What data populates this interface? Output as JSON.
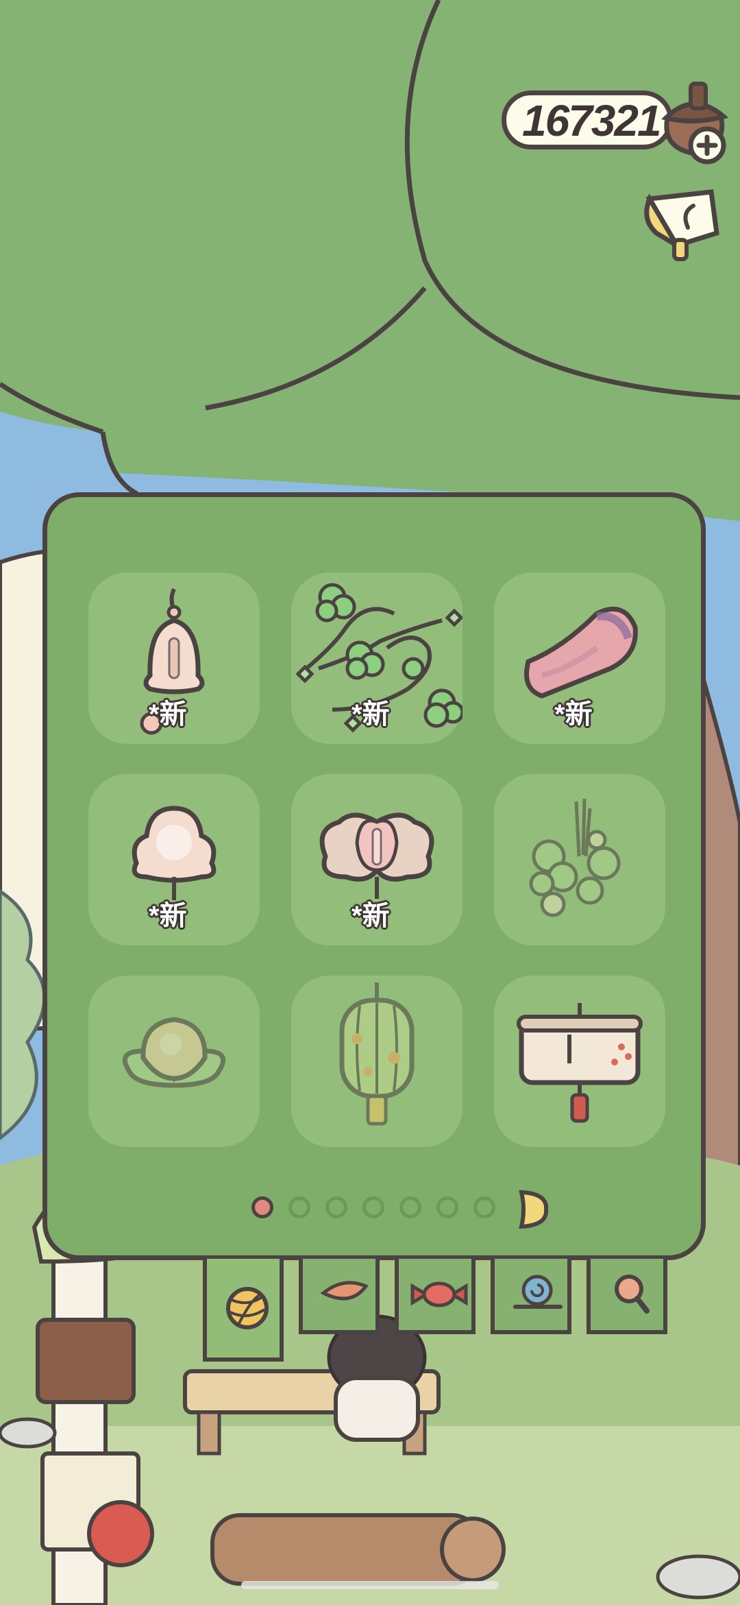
{
  "currency": {
    "amount": "167321",
    "icon": "acorn-plus-icon"
  },
  "top_right": {
    "icon": "notice-flag-icon"
  },
  "panel": {
    "items": [
      {
        "name": "bell-charm-icon",
        "badge": "*新",
        "dimmed": false
      },
      {
        "name": "clover-vine-icon",
        "badge": "*新",
        "dimmed": false
      },
      {
        "name": "petal-scarf-icon",
        "badge": "*新",
        "dimmed": false
      },
      {
        "name": "flower-lamp-icon",
        "badge": "*新",
        "dimmed": false
      },
      {
        "name": "butterfly-ornament-icon",
        "badge": "*新",
        "dimmed": false
      },
      {
        "name": "herb-bouquet-icon",
        "badge": "",
        "dimmed": true
      },
      {
        "name": "peach-bun-icon",
        "badge": "",
        "dimmed": true
      },
      {
        "name": "paper-lantern-icon",
        "badge": "",
        "dimmed": true
      },
      {
        "name": "drum-lantern-icon",
        "badge": "",
        "dimmed": true
      }
    ]
  },
  "pager": {
    "count": 7,
    "active_index": 0,
    "next_icon": "next-page-arrow-icon"
  },
  "tabs": [
    {
      "name": "yarn-ball-icon",
      "active": true
    },
    {
      "name": "leaf-icon",
      "active": false
    },
    {
      "name": "candy-icon",
      "active": false
    },
    {
      "name": "snail-icon",
      "active": false
    },
    {
      "name": "magnifier-icon",
      "active": false
    }
  ],
  "colors": {
    "panel": "#7fae6b",
    "slot": "#93bd7b",
    "outline": "#4b4242",
    "tree": "#84b374"
  }
}
